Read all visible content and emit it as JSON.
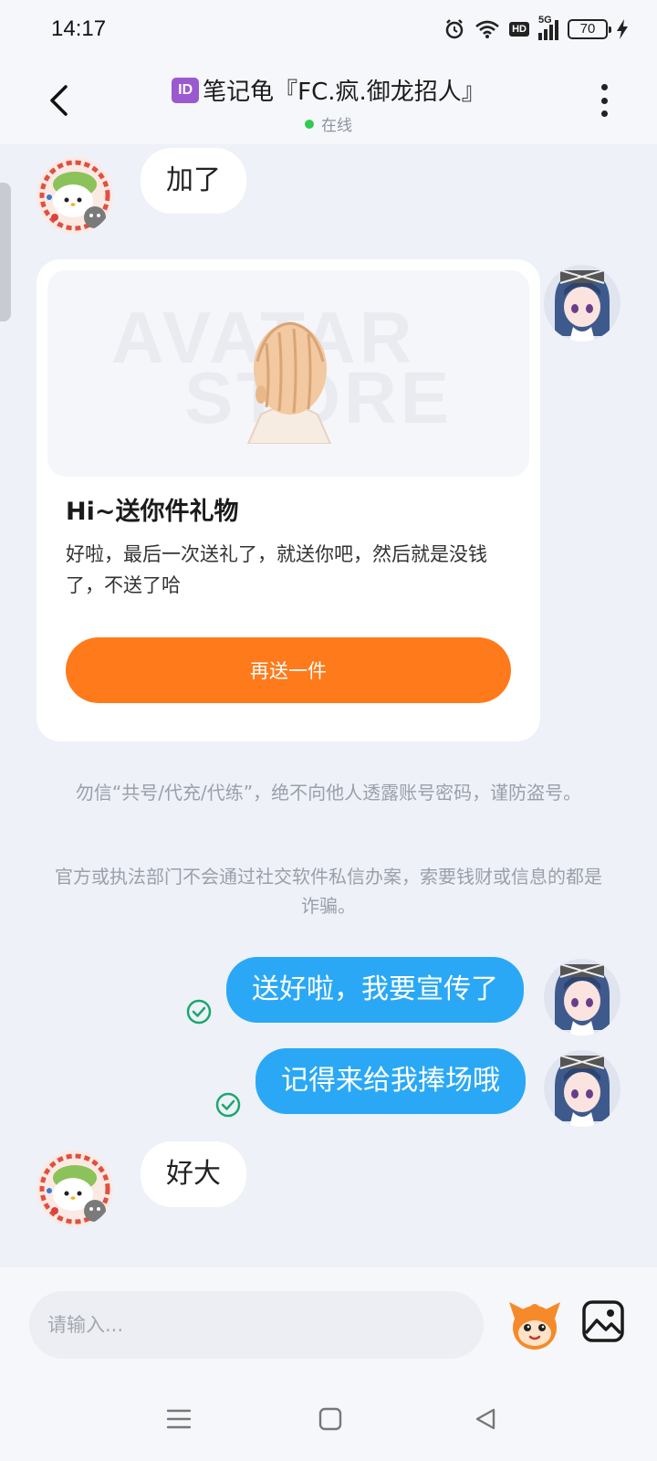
{
  "status_bar": {
    "time": "14:17",
    "network": "5G",
    "hd_label": "HD",
    "battery": "70"
  },
  "header": {
    "id_badge": "ID",
    "title": "笔记龟『FC.疯.御龙招人』",
    "status": "在线"
  },
  "messages": [
    {
      "side": "incoming",
      "text": "加了"
    },
    {
      "side": "outgoing",
      "text": "送好啦，我要宣传了",
      "read": true
    },
    {
      "side": "outgoing",
      "text": "记得来给我捧场哦",
      "read": true
    },
    {
      "side": "incoming",
      "text": "好大"
    }
  ],
  "gift_card": {
    "watermark_line1": "AVATAR",
    "watermark_line2": "STORE",
    "title": "Hi~送你件礼物",
    "description": "好啦，最后一次送礼了，就送你吧，然后就是没钱了，不送了哈",
    "button_label": "再送一件"
  },
  "notices": [
    "勿信“共号/代充/代练”，绝不向他人透露账号密码，谨防盗号。",
    "官方或执法部门不会通过社交软件私信办案，索要钱财或信息的都是诈骗。"
  ],
  "input": {
    "placeholder": "请输入..."
  },
  "colors": {
    "outgoing_bubble": "#2aa8f5",
    "action_button": "#ff7a1a",
    "online_dot": "#2ecc52",
    "read_check": "#1aa86b"
  }
}
